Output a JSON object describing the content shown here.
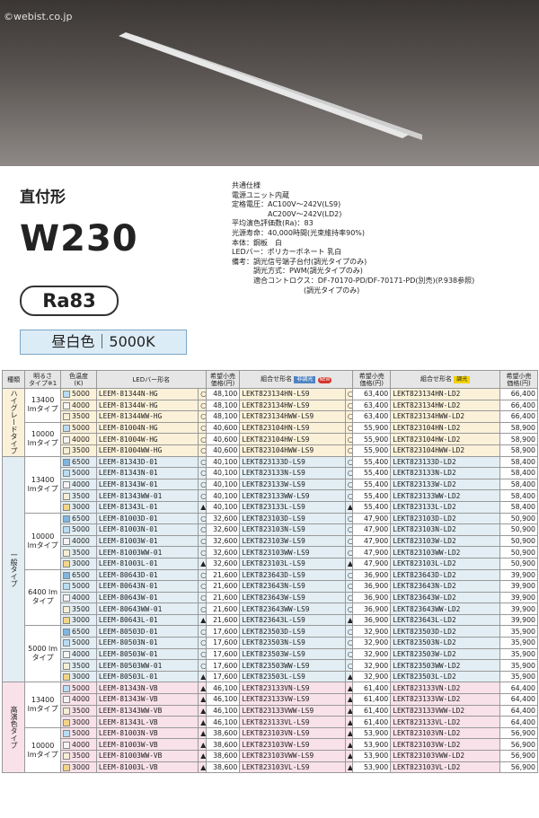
{
  "watermark": "©webist.co.jp",
  "heading": "直付形",
  "model": "W230",
  "ra": "Ra83",
  "color_label": "昼白色｜5000K",
  "spec": [
    "共通仕様",
    "電源ユニット内蔵",
    "定格電圧：AC100V～242V(LS9)",
    "　　　　　AC200V～242V(LD2)",
    "平均演色評価数(Ra)：83",
    "光源寿命：40,000時間(光束維持率90%)",
    "本体：鋼板　白",
    "LEDバー：ポリカーボネート 乳白",
    "備考：調光信号端子台付(調光タイプのみ)",
    "　　　調光方式：PWM(調光タイプのみ)",
    "　　　適合コントロクス：DF-70170-PD/DF-70171-PD(別売)(P.938参照)",
    "　　　　　　　　　　(調光タイプのみ)"
  ],
  "headers": {
    "type": "種類",
    "brightness": "明るさ\nタイプ※1",
    "temp": "色温度\n(K)",
    "bar": "LEDバー形名",
    "price": "希望小売\n価格(円)",
    "set": "組合せ形名",
    "badge_non": "非調光",
    "badge_new": "NEW",
    "badge_dim": "調光"
  },
  "groups": [
    {
      "type": "ハイグレードタイプ",
      "cls": "g-hg",
      "blocks": [
        {
          "lm": "13400 lmタイプ",
          "rows": [
            [
              "5000",
              "LEEM-81344N-HG",
              "○",
              "48,100",
              "LEKT823134HN-LS9",
              "63,400",
              "LEKT823134HN-LD2",
              "66,400"
            ],
            [
              "4000",
              "LEEM-81344W-HG",
              "○",
              "48,100",
              "LEKT823134HW-LS9",
              "63,400",
              "LEKT823134HW-LD2",
              "66,400"
            ],
            [
              "3500",
              "LEEM-81344WW-HG",
              "○",
              "48,100",
              "LEKT823134HWW-LS9",
              "63,400",
              "LEKT823134HWW-LD2",
              "66,400"
            ]
          ]
        },
        {
          "lm": "10000 lmタイプ",
          "rows": [
            [
              "5000",
              "LEEM-81004N-HG",
              "○",
              "40,600",
              "LEKT823104HN-LS9",
              "55,900",
              "LEKT823104HN-LD2",
              "58,900"
            ],
            [
              "4000",
              "LEEM-81004W-HG",
              "○",
              "40,600",
              "LEKT823104HW-LS9",
              "55,900",
              "LEKT823104HW-LD2",
              "58,900"
            ],
            [
              "3500",
              "LEEM-81004WW-HG",
              "○",
              "40,600",
              "LEKT823104HWW-LS9",
              "55,900",
              "LEKT823104HWW-LD2",
              "58,900"
            ]
          ]
        }
      ]
    },
    {
      "type": "一般タイプ",
      "cls": "g-std",
      "blocks": [
        {
          "lm": "13400 lmタイプ",
          "rows": [
            [
              "6500",
              "LEEM-81343D-01",
              "○",
              "40,100",
              "LEKT823133D-LS9",
              "55,400",
              "LEKT823133D-LD2",
              "58,400"
            ],
            [
              "5000",
              "LEEM-81343N-01",
              "○",
              "40,100",
              "LEKT823133N-LS9",
              "55,400",
              "LEKT823133N-LD2",
              "58,400"
            ],
            [
              "4000",
              "LEEM-81343W-01",
              "○",
              "40,100",
              "LEKT823133W-LS9",
              "55,400",
              "LEKT823133W-LD2",
              "58,400"
            ],
            [
              "3500",
              "LEEM-81343WW-01",
              "○",
              "40,100",
              "LEKT823133WW-LS9",
              "55,400",
              "LEKT823133WW-LD2",
              "58,400"
            ],
            [
              "3000",
              "LEEM-81343L-01",
              "▲",
              "40,100",
              "LEKT823133L-LS9",
              "55,400",
              "LEKT823133L-LD2",
              "58,400"
            ]
          ]
        },
        {
          "lm": "10000 lmタイプ",
          "rows": [
            [
              "6500",
              "LEEM-81003D-01",
              "○",
              "32,600",
              "LEKT823103D-LS9",
              "47,900",
              "LEKT823103D-LD2",
              "50,900"
            ],
            [
              "5000",
              "LEEM-81003N-01",
              "○",
              "32,600",
              "LEKT823103N-LS9",
              "47,900",
              "LEKT823103N-LD2",
              "50,900"
            ],
            [
              "4000",
              "LEEM-81003W-01",
              "○",
              "32,600",
              "LEKT823103W-LS9",
              "47,900",
              "LEKT823103W-LD2",
              "50,900"
            ],
            [
              "3500",
              "LEEM-81003WW-01",
              "○",
              "32,600",
              "LEKT823103WW-LS9",
              "47,900",
              "LEKT823103WW-LD2",
              "50,900"
            ],
            [
              "3000",
              "LEEM-81003L-01",
              "▲",
              "32,600",
              "LEKT823103L-LS9",
              "47,900",
              "LEKT823103L-LD2",
              "50,900"
            ]
          ]
        },
        {
          "lm": "6400 lmタイプ",
          "rows": [
            [
              "6500",
              "LEEM-80643D-01",
              "○",
              "21,600",
              "LEKT823643D-LS9",
              "36,900",
              "LEKT823643D-LD2",
              "39,900"
            ],
            [
              "5000",
              "LEEM-80643N-01",
              "○",
              "21,600",
              "LEKT823643N-LS9",
              "36,900",
              "LEKT823643N-LD2",
              "39,900"
            ],
            [
              "4000",
              "LEEM-80643W-01",
              "○",
              "21,600",
              "LEKT823643W-LS9",
              "36,900",
              "LEKT823643W-LD2",
              "39,900"
            ],
            [
              "3500",
              "LEEM-80643WW-01",
              "○",
              "21,600",
              "LEKT823643WW-LS9",
              "36,900",
              "LEKT823643WW-LD2",
              "39,900"
            ],
            [
              "3000",
              "LEEM-80643L-01",
              "▲",
              "21,600",
              "LEKT823643L-LS9",
              "36,900",
              "LEKT823643L-LD2",
              "39,900"
            ]
          ]
        },
        {
          "lm": "5000 lmタイプ",
          "rows": [
            [
              "6500",
              "LEEM-80503D-01",
              "○",
              "17,600",
              "LEKT823503D-LS9",
              "32,900",
              "LEKT823503D-LD2",
              "35,900"
            ],
            [
              "5000",
              "LEEM-80503N-01",
              "○",
              "17,600",
              "LEKT823503N-LS9",
              "32,900",
              "LEKT823503N-LD2",
              "35,900"
            ],
            [
              "4000",
              "LEEM-80503W-01",
              "○",
              "17,600",
              "LEKT823503W-LS9",
              "32,900",
              "LEKT823503W-LD2",
              "35,900"
            ],
            [
              "3500",
              "LEEM-80503WW-01",
              "○",
              "17,600",
              "LEKT823503WW-LS9",
              "32,900",
              "LEKT823503WW-LD2",
              "35,900"
            ],
            [
              "3000",
              "LEEM-80503L-01",
              "▲",
              "17,600",
              "LEKT823503L-LS9",
              "32,900",
              "LEKT823503L-LD2",
              "35,900"
            ]
          ]
        }
      ]
    },
    {
      "type": "高演色タイプ",
      "cls": "g-vb",
      "blocks": [
        {
          "lm": "13400 lmタイプ",
          "rows": [
            [
              "5000",
              "LEEM-81343N-VB",
              "▲",
              "46,100",
              "LEKT823133VN-LS9",
              "61,400",
              "LEKT823133VN-LD2",
              "64,400"
            ],
            [
              "4000",
              "LEEM-81343W-VB",
              "▲",
              "46,100",
              "LEKT823133VW-LS9",
              "61,400",
              "LEKT823133VW-LD2",
              "64,400"
            ],
            [
              "3500",
              "LEEM-81343WW-VB",
              "▲",
              "46,100",
              "LEKT823133VWW-LS9",
              "61,400",
              "LEKT823133VWW-LD2",
              "64,400"
            ],
            [
              "3000",
              "LEEM-81343L-VB",
              "▲",
              "46,100",
              "LEKT823133VL-LS9",
              "61,400",
              "LEKT823133VL-LD2",
              "64,400"
            ]
          ]
        },
        {
          "lm": "10000 lmタイプ",
          "rows": [
            [
              "5000",
              "LEEM-81003N-VB",
              "▲",
              "38,600",
              "LEKT823103VN-LS9",
              "53,900",
              "LEKT823103VN-LD2",
              "56,900"
            ],
            [
              "4000",
              "LEEM-81003W-VB",
              "▲",
              "38,600",
              "LEKT823103VW-LS9",
              "53,900",
              "LEKT823103VW-LD2",
              "56,900"
            ],
            [
              "3500",
              "LEEM-81003WW-VB",
              "▲",
              "38,600",
              "LEKT823103VWW-LS9",
              "53,900",
              "LEKT823103VWW-LD2",
              "56,900"
            ],
            [
              "3000",
              "LEEM-81003L-VB",
              "▲",
              "38,600",
              "LEKT823103VL-LS9",
              "53,900",
              "LEKT823103VL-LD2",
              "56,900"
            ]
          ]
        }
      ]
    }
  ],
  "swatch_colors": {
    "6500": "#7fb6e0",
    "5000": "#b9dcf2",
    "4000": "#f4f4f4",
    "3500": "#f5efd6",
    "3000": "#f2d58a"
  }
}
